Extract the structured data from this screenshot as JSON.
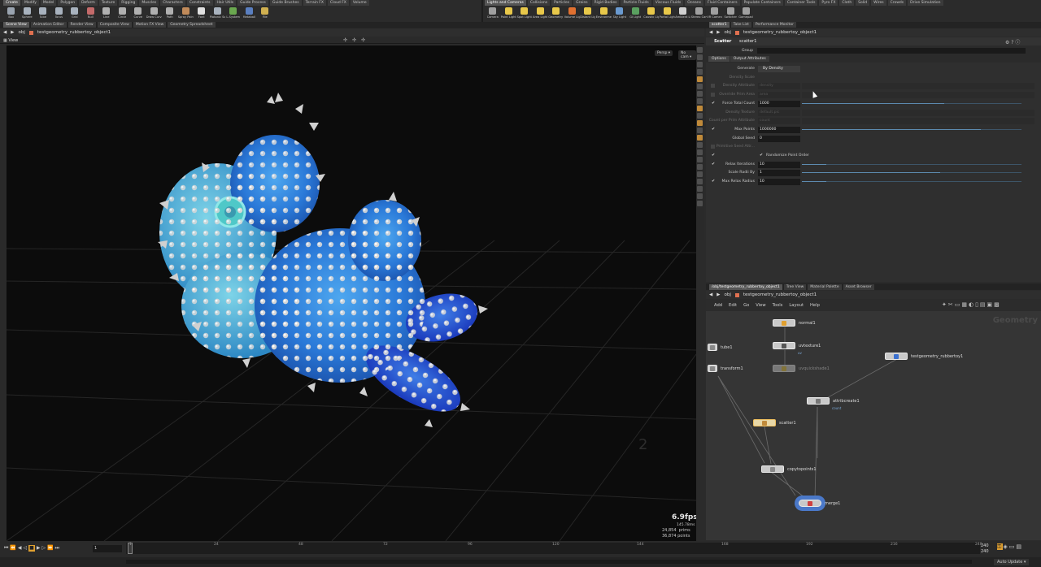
{
  "top_tabs_left": [
    "Create",
    "Modify",
    "Model",
    "Polygon",
    "Deform",
    "Texture",
    "Rigging",
    "Muscles",
    "Characters",
    "Constraints",
    "Hair Utils",
    "Guide Process",
    "Guide Brushes",
    "Terrain FX",
    "Cloud FX",
    "Volume"
  ],
  "top_tabs_right": [
    "Lights and Cameras",
    "Collisions",
    "Particles",
    "Grains",
    "Rigid Bodies",
    "Particle Fluids",
    "Viscous Fluids",
    "Oceans",
    "Fluid Containers",
    "Populate Containers",
    "Container Tools",
    "Pyro FX",
    "Cloth",
    "Solid",
    "Wires",
    "Crowds",
    "Drive Simulation"
  ],
  "shelf_left": [
    {
      "label": "Box",
      "icon": "box-icon",
      "color": "#9aa4b0"
    },
    {
      "label": "Sphere",
      "icon": "sphere-icon",
      "color": "#a8b2be"
    },
    {
      "label": "Tube",
      "icon": "tube-icon",
      "color": "#a8b2be"
    },
    {
      "label": "Torus",
      "icon": "torus-icon",
      "color": "#a8b2be"
    },
    {
      "label": "Grid",
      "icon": "grid-icon",
      "color": "#a8b2be"
    },
    {
      "label": "Null",
      "icon": "null-icon",
      "color": "#c46a6a"
    },
    {
      "label": "Line",
      "icon": "line-icon",
      "color": "#b0b0b0"
    },
    {
      "label": "Circle",
      "icon": "circle-icon",
      "color": "#b0b0b0"
    },
    {
      "label": "Curve",
      "icon": "curve-icon",
      "color": "#b0b0b0"
    },
    {
      "label": "Draw Curve",
      "icon": "draw-curve-icon",
      "color": "#b0b0b0"
    },
    {
      "label": "Path",
      "icon": "path-icon",
      "color": "#b0b0b0"
    },
    {
      "label": "Spray Paint",
      "icon": "spray-paint-icon",
      "color": "#c08a5a"
    },
    {
      "label": "Font",
      "icon": "font-icon",
      "color": "#e0e0e0"
    },
    {
      "label": "Platonic Solids",
      "icon": "platonic-icon",
      "color": "#a8b2be"
    },
    {
      "label": "L-System",
      "icon": "lsystem-icon",
      "color": "#6aa84f"
    },
    {
      "label": "Metaball",
      "icon": "metaball-icon",
      "color": "#5a7fc0"
    },
    {
      "label": "File",
      "icon": "file-icon",
      "color": "#d0b050"
    }
  ],
  "shelf_right": [
    {
      "label": "Camera",
      "icon": "camera-icon",
      "color": "#a0a0a0"
    },
    {
      "label": "Point Light",
      "icon": "point-light-icon",
      "color": "#e8c84a"
    },
    {
      "label": "Spot Light",
      "icon": "spot-light-icon",
      "color": "#e8c84a"
    },
    {
      "label": "Area Light",
      "icon": "area-light-icon",
      "color": "#e8c84a"
    },
    {
      "label": "Geometry Light",
      "icon": "geometry-light-icon",
      "color": "#e8c84a"
    },
    {
      "label": "Volume Light",
      "icon": "volume-light-icon",
      "color": "#e07030"
    },
    {
      "label": "Distant Light",
      "icon": "distant-light-icon",
      "color": "#e8c84a"
    },
    {
      "label": "Environment Light",
      "icon": "environment-light-icon",
      "color": "#e8c84a"
    },
    {
      "label": "Sky Light",
      "icon": "sky-light-icon",
      "color": "#6a9ad0"
    },
    {
      "label": "GI Light",
      "icon": "gi-light-icon",
      "color": "#5aa060"
    },
    {
      "label": "Caustic Light",
      "icon": "caustic-light-icon",
      "color": "#e8c84a"
    },
    {
      "label": "Portal Light",
      "icon": "portal-light-icon",
      "color": "#e8c84a"
    },
    {
      "label": "Ambient Light",
      "icon": "ambient-light-icon",
      "color": "#d0d0d0"
    },
    {
      "label": "Stereo Camera",
      "icon": "stereo-camera-icon",
      "color": "#a0a0a0"
    },
    {
      "label": "VR Camera",
      "icon": "vr-camera-icon",
      "color": "#a0a0a0"
    },
    {
      "label": "Switcher",
      "icon": "switcher-icon",
      "color": "#a0a0a0"
    },
    {
      "label": "Gamepad Camera",
      "icon": "gamepad-camera-icon",
      "color": "#a0a0a0"
    }
  ],
  "left_pane_tabs": [
    "Scene View",
    "Animation Editor",
    "Render View",
    "Composite View",
    "Motion FX View",
    "Geometry Spreadsheet"
  ],
  "right_top_tabs": [
    "scatter1",
    "Take List",
    "Performance Monitor"
  ],
  "path": {
    "root": "obj",
    "object": "testgeometry_rubbertoy_object1"
  },
  "viewport": {
    "title": "View",
    "persp": "Persp",
    "cam": "No cam",
    "fps": "6.9fps",
    "ms": "145.78ms",
    "prims": "24,854  prims",
    "points": "36,874 points"
  },
  "params": {
    "node_type": "Scatter",
    "node_name": "scatter1",
    "group_label": "Group",
    "tabs": [
      "Options",
      "Output Attributes"
    ],
    "rows": [
      {
        "label": "Generate",
        "value": "By Density",
        "dim": false,
        "chk": ""
      },
      {
        "label": "Density Scale",
        "value": "",
        "dim": true,
        "chk": ""
      },
      {
        "label": "Density Attribute",
        "value": "density",
        "dim": true,
        "chk": "lock"
      },
      {
        "label": "Override Prim Area",
        "value": "area",
        "dim": true,
        "chk": "lock"
      },
      {
        "label": "Force Total Count",
        "value": "1000",
        "dim": false,
        "chk": "✔"
      },
      {
        "label": "Density Texture",
        "value": "default.pic",
        "dim": true,
        "chk": ""
      },
      {
        "label": "Count per Prim Attribute",
        "value": "count",
        "dim": true,
        "chk": ""
      },
      {
        "label": "Max Points",
        "value": "1000000",
        "dim": false,
        "chk": "✔"
      },
      {
        "label": "Global Seed",
        "value": "0",
        "dim": false,
        "chk": ""
      },
      {
        "label": "Primitive Seed Attr...",
        "value": "",
        "dim": true,
        "chk": "lock"
      },
      {
        "label": "Randomize Point Order",
        "value": "",
        "dim": false,
        "chk": "✔"
      },
      {
        "label": "Relax Iterations",
        "value": "10",
        "dim": false,
        "chk": "✔"
      },
      {
        "label": "Scale Radii By",
        "value": "1",
        "dim": false,
        "chk": ""
      },
      {
        "label": "Max Relax Radius",
        "value": "10",
        "dim": false,
        "chk": "✔"
      }
    ]
  },
  "network_tabs": [
    "/obj/testgeometry_rubbertoy_object1",
    "Tree View",
    "Material Palette",
    "Asset Browser"
  ],
  "network_menu": [
    "Add",
    "Edit",
    "Go",
    "View",
    "Tools",
    "Layout",
    "Help"
  ],
  "network_context": "Geometry",
  "nodes": [
    {
      "name": "normal1",
      "sub": ""
    },
    {
      "name": "uvtexture1",
      "sub": "uv"
    },
    {
      "name": "tube1",
      "sub": ""
    },
    {
      "name": "transform1",
      "sub": ""
    },
    {
      "name": "uvquickshade1",
      "sub": ""
    },
    {
      "name": "testgeometry_rubbertoy1",
      "sub": ""
    },
    {
      "name": "attribcreate1",
      "sub": "count"
    },
    {
      "name": "scatter1",
      "sub": ""
    },
    {
      "name": "copytopoints1",
      "sub": ""
    },
    {
      "name": "merge1",
      "sub": ""
    }
  ],
  "timeline": {
    "ticks": [
      "1",
      "24",
      "48",
      "72",
      "96",
      "120",
      "144",
      "168",
      "192",
      "216",
      "240"
    ],
    "current_frame": "1",
    "start": "1",
    "end_top": "240",
    "end_bottom": "240",
    "auto_update": "Auto Update"
  }
}
